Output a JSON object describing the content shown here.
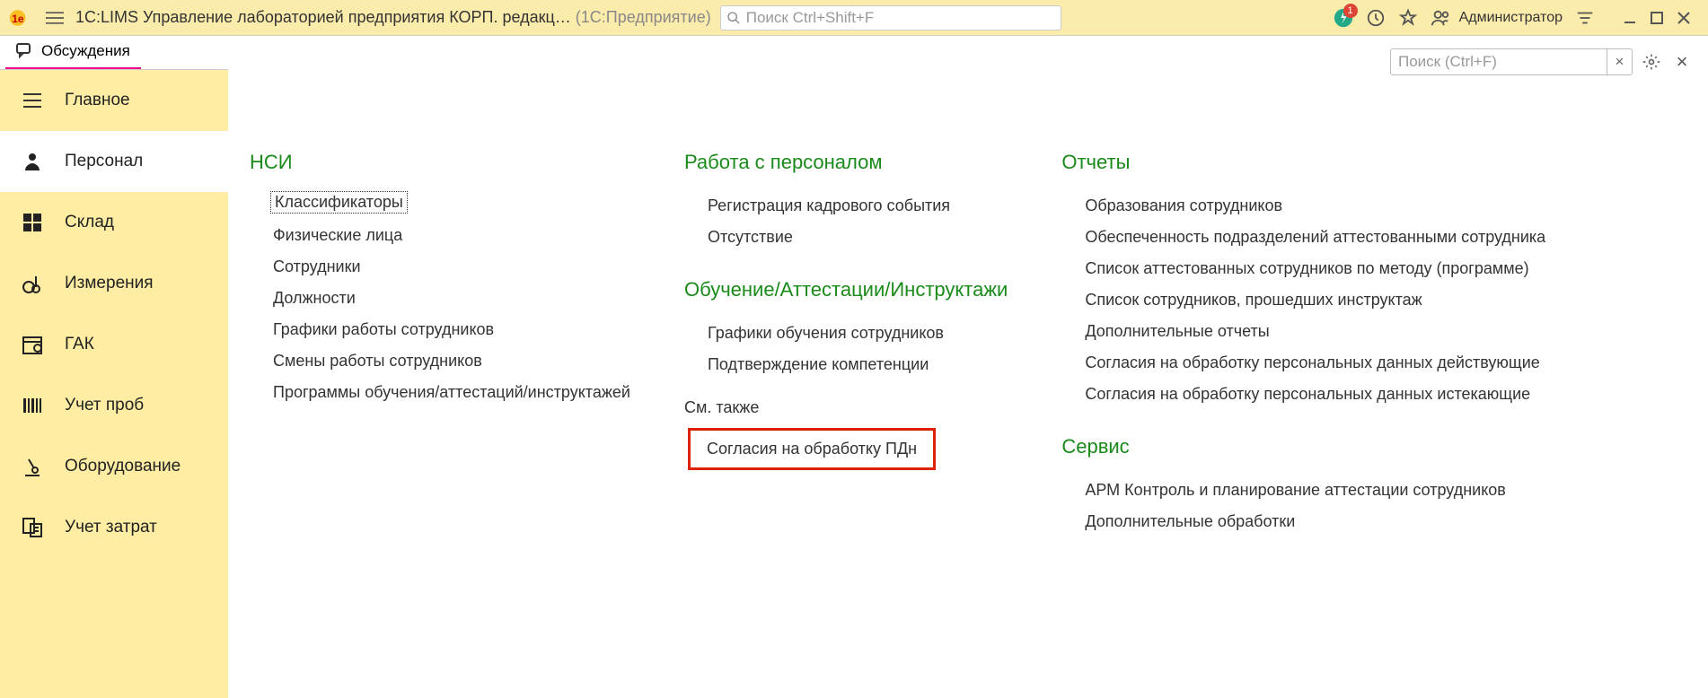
{
  "header": {
    "title_main": "1С:LIMS Управление лабораторией предприятия КОРП. редакц…",
    "title_suffix": "(1С:Предприятие)",
    "search_placeholder": "Поиск Ctrl+Shift+F",
    "bell_count": "1",
    "username": "Администратор"
  },
  "tabs": {
    "discussions": "Обсуждения"
  },
  "sidebar": {
    "items": [
      {
        "label": "Главное"
      },
      {
        "label": "Персонал"
      },
      {
        "label": "Склад"
      },
      {
        "label": "Измерения"
      },
      {
        "label": "ГАК"
      },
      {
        "label": "Учет проб"
      },
      {
        "label": "Оборудование"
      },
      {
        "label": "Учет затрат"
      }
    ]
  },
  "content": {
    "search_placeholder": "Поиск (Ctrl+F)",
    "clear": "×",
    "close": "×",
    "col1": {
      "title": "НСИ",
      "links": [
        "Классификаторы",
        "Физические лица",
        "Сотрудники",
        "Должности",
        "Графики работы сотрудников",
        "Смены работы сотрудников",
        "Программы обучения/аттестаций/инструктажей"
      ]
    },
    "col2": {
      "title1": "Работа с персоналом",
      "links1": [
        "Регистрация кадрового события",
        "Отсутствие"
      ],
      "title2": "Обучение/Аттестации/Инструктажи",
      "links2": [
        "Графики обучения сотрудников",
        "Подтверждение компетенции"
      ],
      "see_also_label": "См. также",
      "see_also_link": "Согласия на обработку ПДн"
    },
    "col3": {
      "title1": "Отчеты",
      "links1": [
        "Образования сотрудников",
        "Обеспеченность подразделений аттестованными сотрудника",
        "Список аттестованных сотрудников по методу (программе)",
        "Список сотрудников, прошедших инструктаж",
        "Дополнительные отчеты",
        "Согласия на обработку персональных данных действующие",
        "Согласия на обработку персональных данных истекающие"
      ],
      "title2": "Сервис",
      "links2": [
        "АРМ Контроль и планирование аттестации сотрудников",
        "Дополнительные обработки"
      ]
    }
  }
}
